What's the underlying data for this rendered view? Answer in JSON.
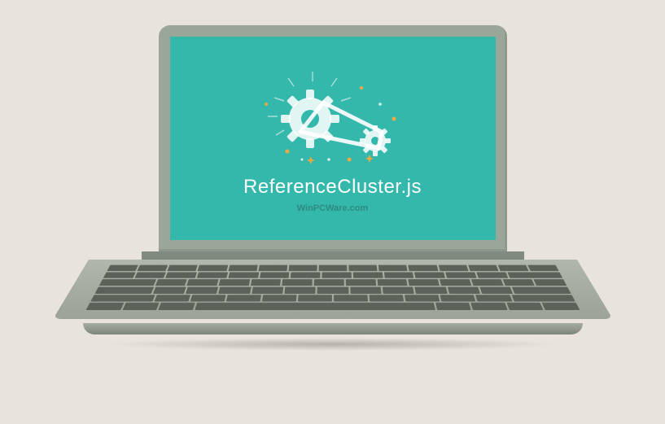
{
  "filename": "ReferenceCluster.js",
  "watermark": "WinPCWare.com",
  "colors": {
    "background": "#e8e3dd",
    "screen": "#35b8ac",
    "frame": "#9aa698",
    "accent": "#f0a840"
  }
}
